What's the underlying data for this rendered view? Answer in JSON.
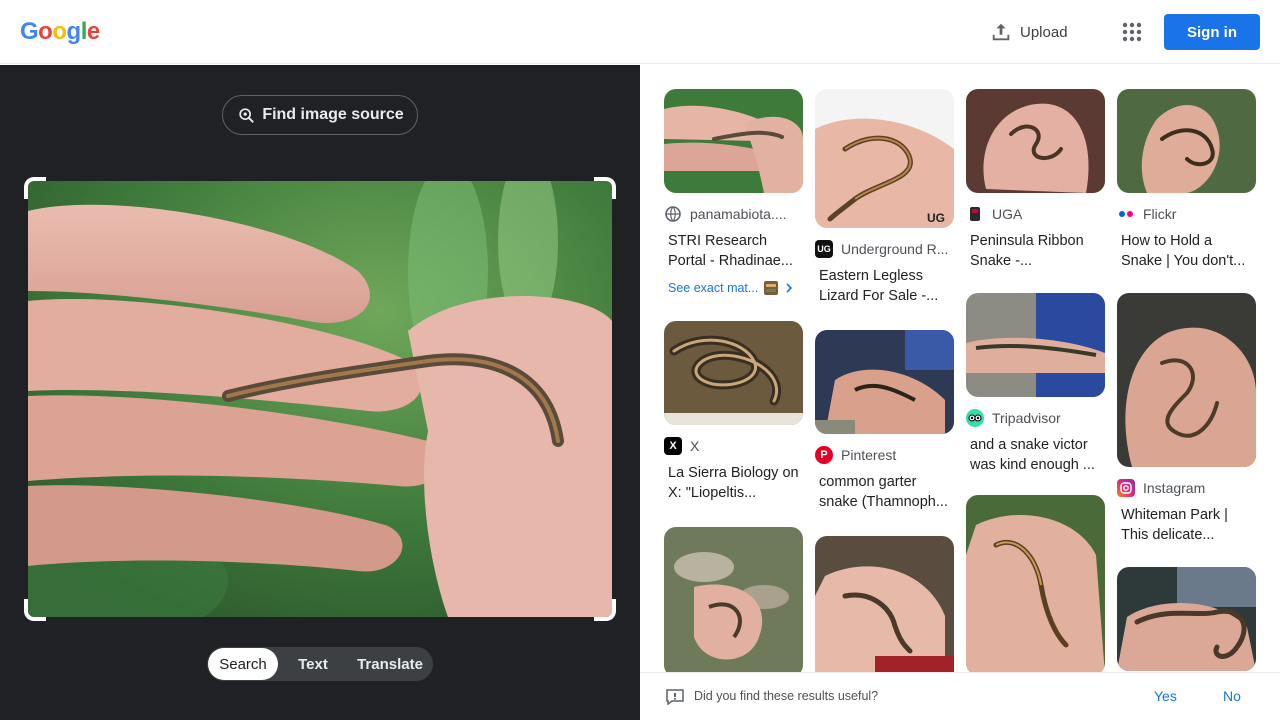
{
  "header": {
    "logo_letters": [
      "G",
      "o",
      "o",
      "g",
      "l",
      "e"
    ],
    "logo_colors": [
      "#4285f4",
      "#ea4335",
      "#fbbc05",
      "#4285f4",
      "#34a853",
      "#ea4335"
    ],
    "upload_label": "Upload",
    "signin_label": "Sign in"
  },
  "left": {
    "find_source_label": "Find image source",
    "modes": [
      {
        "label": "Search",
        "active": true
      },
      {
        "label": "Text",
        "active": false
      },
      {
        "label": "Translate",
        "active": false
      }
    ]
  },
  "results": {
    "col1": [
      {
        "source": "panamabiota....",
        "title": "STRI Research Portal - Rhadinae...",
        "icon": "globe-icon",
        "exact": "See exact mat..."
      },
      {
        "source": "X",
        "title": "La Sierra Biology on X: \"Liopeltis...",
        "icon": "x-logo-icon"
      },
      {
        "source": "",
        "title": "",
        "icon": ""
      }
    ],
    "col2": [
      {
        "source": "Underground R...",
        "title": "Eastern Legless Lizard For Sale -...",
        "icon": "ug-logo-icon"
      },
      {
        "source": "Pinterest",
        "title": "common garter snake (Thamnoph...",
        "icon": "pinterest-icon"
      },
      {
        "source": "",
        "title": "",
        "icon": ""
      }
    ],
    "col3": [
      {
        "source": "UGA",
        "title": "Peninsula Ribbon Snake -...",
        "icon": "uga-icon"
      },
      {
        "source": "Tripadvisor",
        "title": "and a snake victor was kind enough ...",
        "icon": "tripadvisor-icon"
      },
      {
        "source": "",
        "title": "",
        "icon": ""
      }
    ],
    "col4": [
      {
        "source": "Flickr",
        "title": "How to Hold a Snake | You don't...",
        "icon": "flickr-icon"
      },
      {
        "source": "Instagram",
        "title": "Whiteman Park | This delicate...",
        "icon": "instagram-icon"
      },
      {
        "source": "",
        "title": "",
        "icon": ""
      }
    ]
  },
  "feedback": {
    "question": "Did you find these results useful?",
    "yes": "Yes",
    "no": "No"
  },
  "colors": {
    "accent": "#1a73e8",
    "dark_panel": "#202124"
  }
}
